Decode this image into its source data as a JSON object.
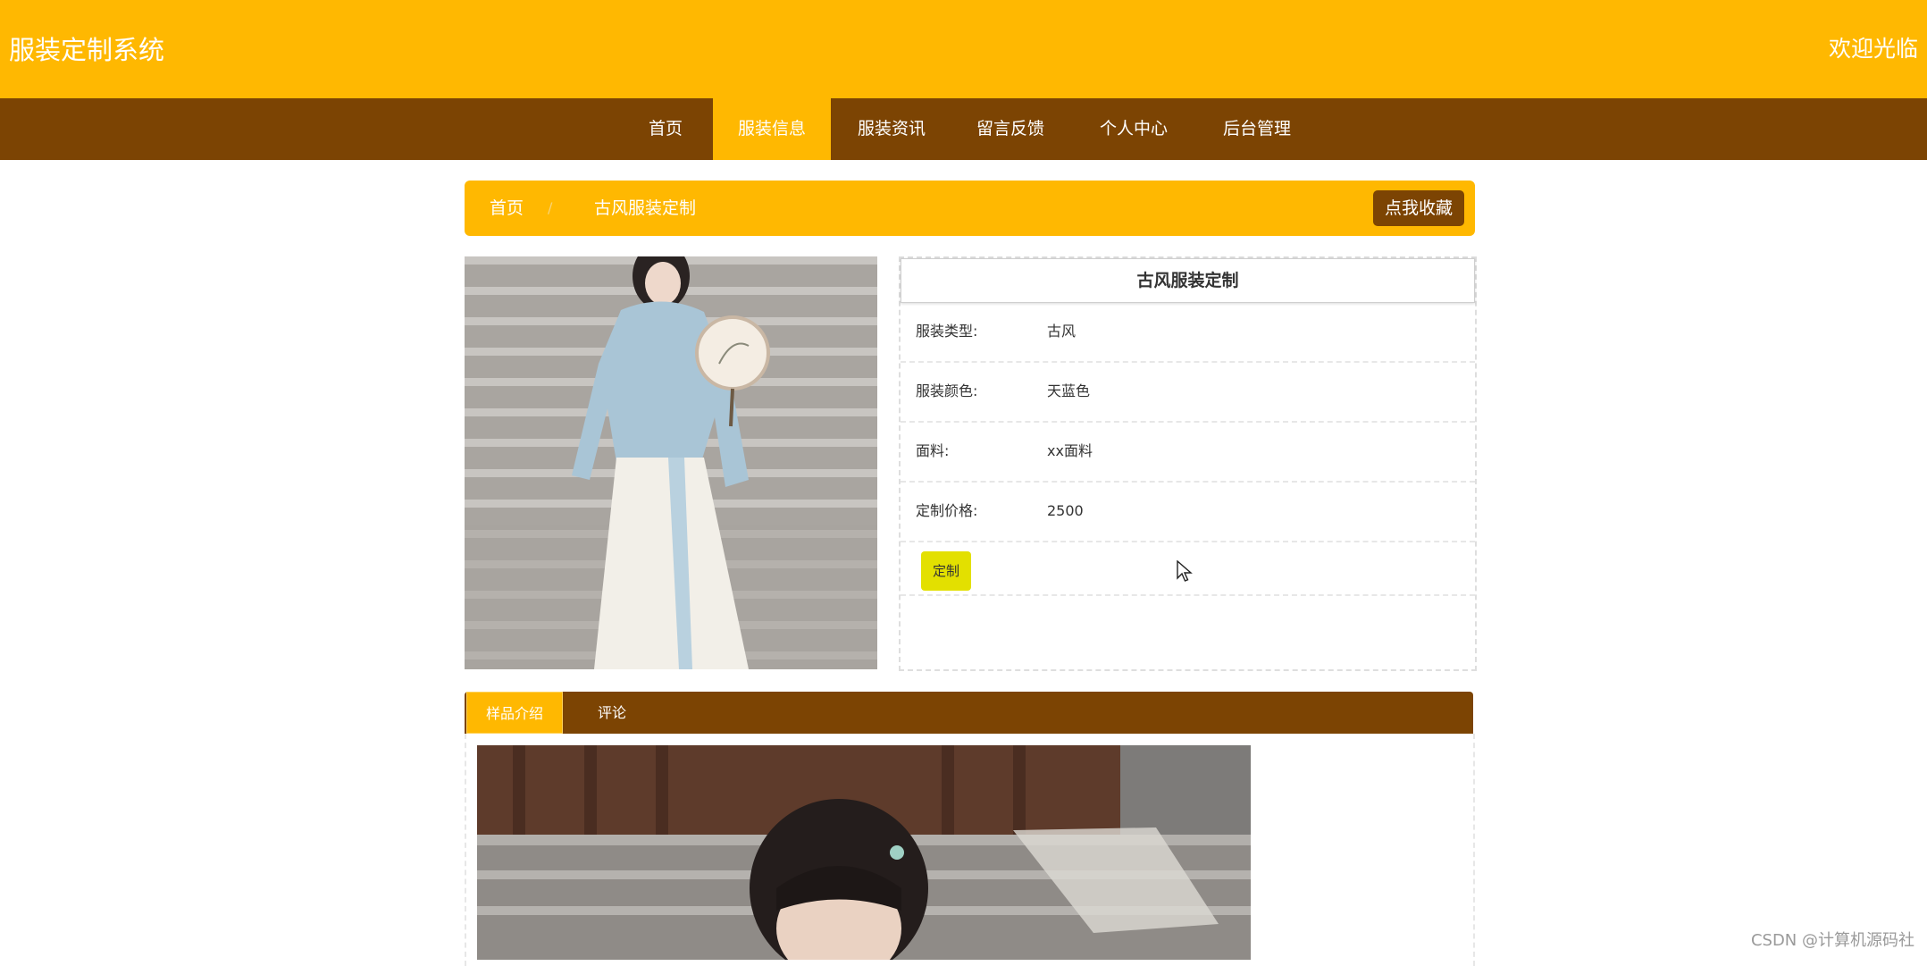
{
  "header": {
    "site_title": "服装定制系统",
    "welcome": "欢迎光临"
  },
  "nav": {
    "items": [
      {
        "label": "首页"
      },
      {
        "label": "服装信息",
        "active": true
      },
      {
        "label": "服装资讯"
      },
      {
        "label": "留言反馈"
      },
      {
        "label": "个人中心"
      },
      {
        "label": "后台管理"
      }
    ]
  },
  "breadcrumb": {
    "home": "首页",
    "separator": "/",
    "current": "古风服装定制",
    "favorite_button": "点我收藏"
  },
  "product": {
    "title": "古风服装定制",
    "fields": [
      {
        "label": "服装类型:",
        "value": "古风"
      },
      {
        "label": "服装颜色:",
        "value": "天蓝色"
      },
      {
        "label": "面料:",
        "value": "xx面料"
      },
      {
        "label": "定制价格:",
        "value": "2500"
      }
    ],
    "custom_button": "定制"
  },
  "tabs": [
    {
      "label": "样品介绍",
      "active": true
    },
    {
      "label": "评论"
    }
  ],
  "watermark": "CSDN @计算机源码社",
  "colors": {
    "primary": "#ffb801",
    "dark": "#7c4403",
    "button_yellow": "#e3e000"
  }
}
